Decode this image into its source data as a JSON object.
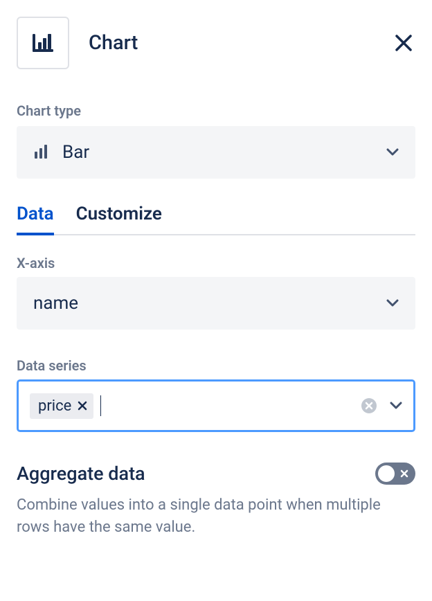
{
  "header": {
    "title": "Chart"
  },
  "chart_type": {
    "label": "Chart type",
    "value": "Bar"
  },
  "tabs": [
    {
      "label": "Data",
      "active": true
    },
    {
      "label": "Customize",
      "active": false
    }
  ],
  "x_axis": {
    "label": "X-axis",
    "value": "name"
  },
  "data_series": {
    "label": "Data series",
    "chips": [
      {
        "label": "price"
      }
    ]
  },
  "aggregate": {
    "label": "Aggregate data",
    "enabled": false,
    "description": "Combine values into a single data point when multiple rows have the same value."
  }
}
